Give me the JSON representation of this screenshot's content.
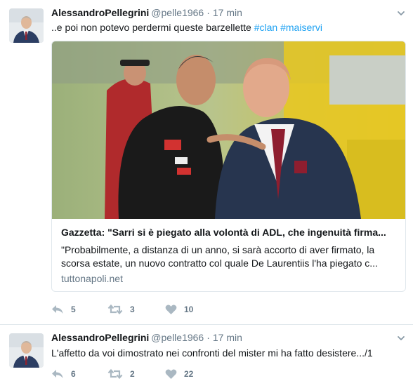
{
  "tweets": [
    {
      "author": {
        "name": "AlessandroPellegrini",
        "handle": "@pelle1966"
      },
      "separator": "·",
      "time": "17 min",
      "text": "..e poi non potevo perdermi queste barzellette ",
      "hashtags": [
        "#clan",
        "#maiservi"
      ],
      "card": {
        "title": "Gazzetta: \"Sarri si è piegato alla volontà di ADL, che ingenuità firma...",
        "description": "\"Probabilmente, a distanza di un anno, si sarà accorto di aver firmato, la scorsa estate, un nuovo contratto col quale De Laurentiis l'ha piegato c...",
        "domain": "tuttonapoli.net"
      },
      "actions": {
        "replies": "5",
        "retweets": "3",
        "likes": "10"
      }
    },
    {
      "author": {
        "name": "AlessandroPellegrini",
        "handle": "@pelle1966"
      },
      "separator": "·",
      "time": "17 min",
      "text": "L'affetto da voi dimostrato nei confronti del mister mi ha fatto desistere.../1",
      "actions": {
        "replies": "6",
        "retweets": "2",
        "likes": "22"
      }
    }
  ],
  "icons": {
    "reply": "reply-icon",
    "retweet": "retweet-icon",
    "like": "heart-icon",
    "more": "chevron-down-icon"
  },
  "colors": {
    "link": "#1da1f2",
    "muted": "#657786",
    "text": "#14171a",
    "border": "#e1e8ed"
  }
}
